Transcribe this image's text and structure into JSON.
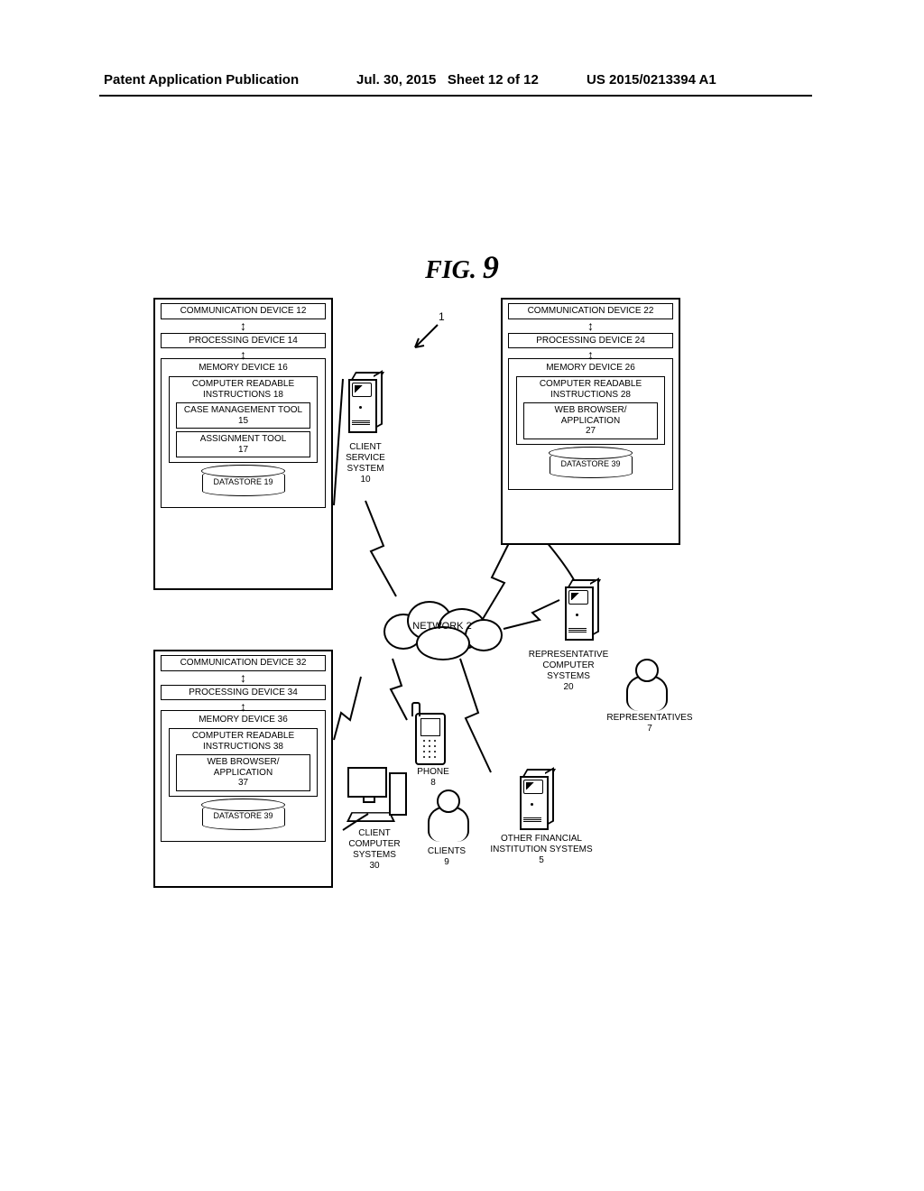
{
  "header": {
    "left": "Patent Application Publication",
    "mid_date": "Jul. 30, 2015",
    "mid_sheet": "Sheet 12 of 12",
    "right": "US 2015/0213394 A1"
  },
  "figure_label": "FIG.",
  "figure_number": "9",
  "ref_1": "1",
  "network": {
    "label": "NETWORK 2"
  },
  "system_left_top": {
    "comm": "COMMUNICATION DEVICE 12",
    "proc": "PROCESSING DEVICE 14",
    "mem": "MEMORY DEVICE 16",
    "instr": "COMPUTER READABLE INSTRUCTIONS 18",
    "tool1": "CASE MANAGEMENT TOOL\n15",
    "tool2": "ASSIGNMENT TOOL\n17",
    "datastore": "DATASTORE 19"
  },
  "system_right_top": {
    "comm": "COMMUNICATION DEVICE 22",
    "proc": "PROCESSING DEVICE 24",
    "mem": "MEMORY DEVICE 26",
    "instr": "COMPUTER READABLE INSTRUCTIONS 28",
    "app": "WEB BROWSER/ APPLICATION\n27",
    "datastore": "DATASTORE 39"
  },
  "system_left_bottom": {
    "comm": "COMMUNICATION DEVICE 32",
    "proc": "PROCESSING DEVICE 34",
    "mem": "MEMORY DEVICE 36",
    "instr": "COMPUTER READABLE INSTRUCTIONS 38",
    "app": "WEB BROWSER/ APPLICATION\n37",
    "datastore": "DATASTORE 39"
  },
  "labels": {
    "client_service_system": "CLIENT SERVICE SYSTEM\n10",
    "rep_computer_systems": "REPRESENTATIVE COMPUTER SYSTEMS\n20",
    "representatives": "REPRESENTATIVES\n7",
    "phone": "PHONE\n8",
    "client_computer_systems": "CLIENT COMPUTER SYSTEMS\n30",
    "clients": "CLIENTS\n9",
    "other_fin": "OTHER FINANCIAL INSTITUTION SYSTEMS\n5"
  }
}
